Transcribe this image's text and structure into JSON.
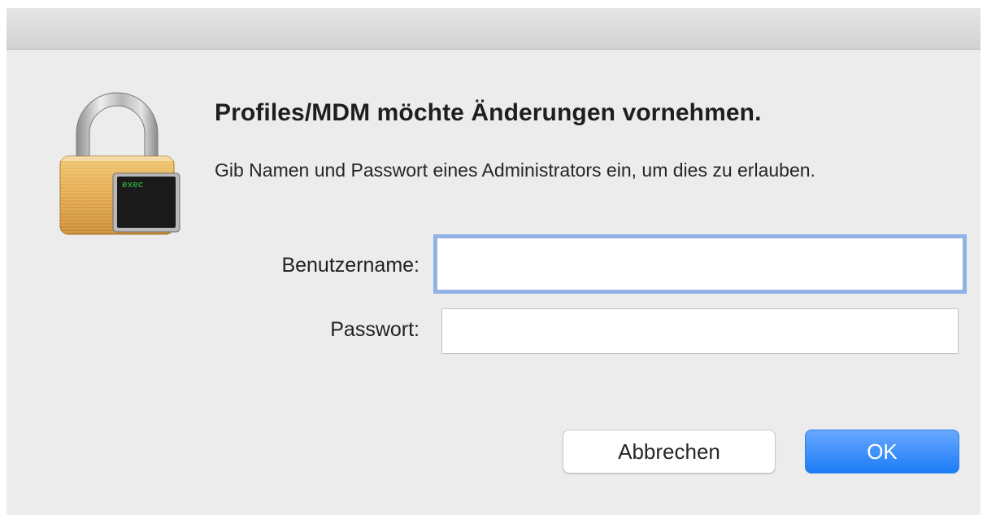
{
  "dialog": {
    "headline": "Profiles/MDM möchte Änderungen vornehmen.",
    "message": "Gib Namen und Passwort eines Administrators ein, um dies zu erlauben."
  },
  "form": {
    "username_label": "Benutzername:",
    "username_value": "",
    "password_label": "Passwort:",
    "password_value": ""
  },
  "buttons": {
    "cancel_label": "Abbrechen",
    "ok_label": "OK"
  },
  "icons": {
    "app_icon": "lock-icon",
    "badge_icon": "exec-terminal-icon",
    "badge_text": "exec"
  },
  "colors": {
    "accent": "#1b7cf6",
    "focus_ring": "#8fb1ea",
    "window_background": "#ececec"
  }
}
